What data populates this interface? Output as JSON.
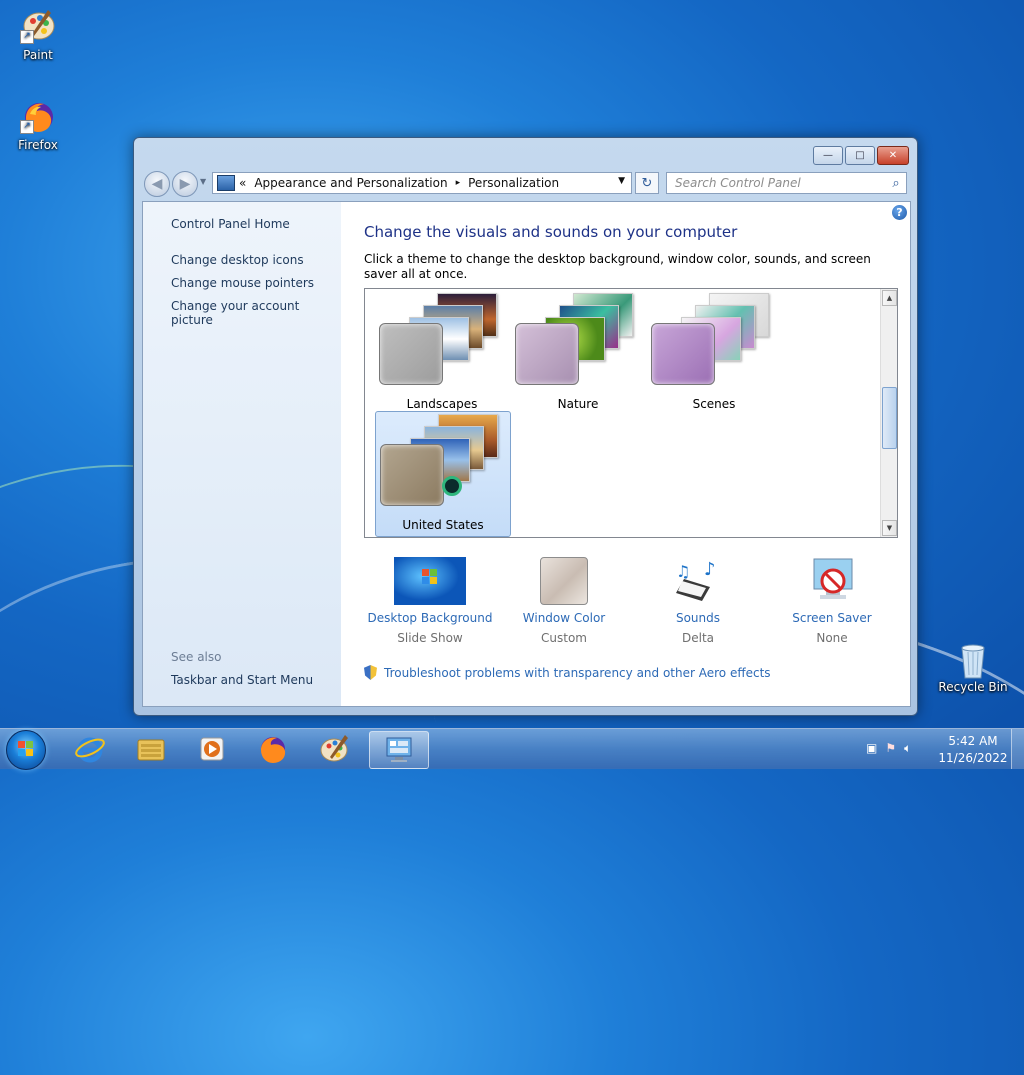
{
  "desktop": {
    "icons": [
      {
        "label": "Paint"
      },
      {
        "label": "Firefox"
      },
      {
        "label": "Recycle Bin"
      }
    ]
  },
  "window": {
    "address": {
      "chevron": "«",
      "segments": [
        "Appearance and Personalization",
        "Personalization"
      ],
      "separator": "▸"
    },
    "search_placeholder": "Search Control Panel",
    "caption": {
      "minimize": "—",
      "maximize": "□",
      "close": "✕"
    }
  },
  "left_pane": {
    "home": "Control Panel Home",
    "links": [
      "Change desktop icons",
      "Change mouse pointers",
      "Change your account picture"
    ],
    "see_also_heading": "See also",
    "see_also_links": [
      "Taskbar and Start Menu"
    ]
  },
  "main": {
    "title": "Change the visuals and sounds on your computer",
    "subtitle": "Click a theme to change the desktop background, window color, sounds, and screen saver all at once.",
    "themes": [
      {
        "name": "Landscapes",
        "selected": false
      },
      {
        "name": "Nature",
        "selected": false
      },
      {
        "name": "Scenes",
        "selected": false
      },
      {
        "name": "United States",
        "selected": true
      }
    ],
    "settings": [
      {
        "label": "Desktop Background",
        "value": "Slide Show",
        "icon": "desktop-background-icon"
      },
      {
        "label": "Window Color",
        "value": "Custom",
        "icon": "window-color-icon"
      },
      {
        "label": "Sounds",
        "value": "Delta",
        "icon": "sounds-icon"
      },
      {
        "label": "Screen Saver",
        "value": "None",
        "icon": "screen-saver-icon"
      }
    ],
    "troubleshoot": "Troubleshoot problems with transparency and other Aero effects"
  },
  "taskbar": {
    "pinned": [
      "internet-explorer-icon",
      "file-explorer-icon",
      "media-player-icon",
      "firefox-icon",
      "paint-icon",
      "personalization-icon"
    ],
    "time": "5:42 AM",
    "date": "11/26/2022"
  }
}
